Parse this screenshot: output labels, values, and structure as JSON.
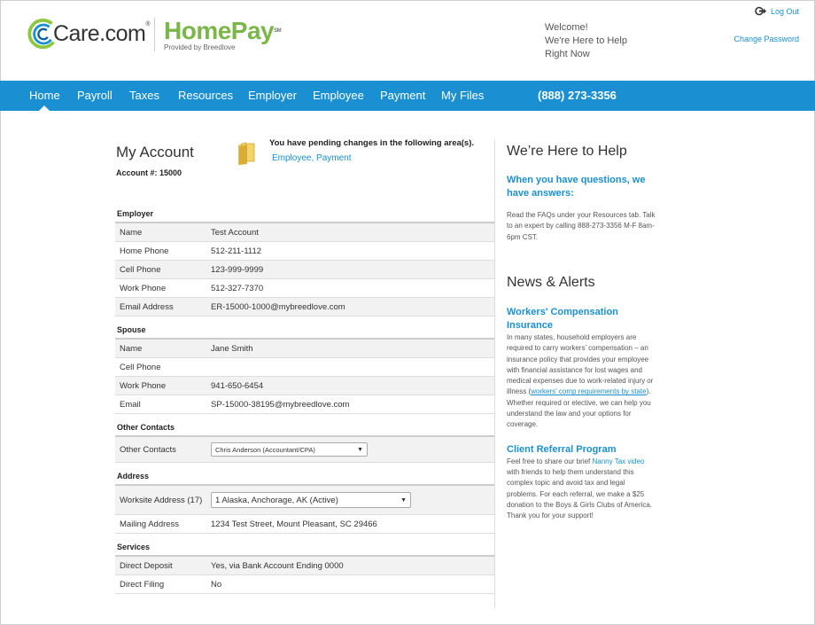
{
  "header": {
    "care_logo": "Care.com",
    "homepay_logo": "HomePay",
    "homepay_sub": "Provided by Breedlove",
    "welcome": [
      "Welcome!",
      "We're Here to Help",
      "Right Now"
    ],
    "logout": "Log Out",
    "change_password": "Change Password"
  },
  "nav": {
    "items": [
      "Home",
      "Payroll",
      "Taxes",
      "Resources",
      "Employer",
      "Employee",
      "Payment",
      "My Files"
    ],
    "phone": "(888) 273-3356",
    "active": "Home"
  },
  "account": {
    "title": "My Account",
    "number": "Account #: 15000",
    "pending_text": "You have pending changes in the following area(s).",
    "pending_links": "Employee, Payment"
  },
  "sections": {
    "employer": {
      "title": "Employer",
      "rows": [
        {
          "label": "Name",
          "value": "Test Account"
        },
        {
          "label": "Home Phone",
          "value": "512-211-1112"
        },
        {
          "label": "Cell Phone",
          "value": "123-999-9999"
        },
        {
          "label": "Work Phone",
          "value": "512-327-7370"
        },
        {
          "label": "Email Address",
          "value": "ER-15000-1000@mybreedlove.com"
        }
      ]
    },
    "spouse": {
      "title": "Spouse",
      "rows": [
        {
          "label": "Name",
          "value": "Jane Smith"
        },
        {
          "label": "Cell Phone",
          "value": ""
        },
        {
          "label": "Work Phone",
          "value": "941-650-6454"
        },
        {
          "label": "Email",
          "value": "SP-15000-38195@mybreedlove.com"
        }
      ]
    },
    "other": {
      "title": "Other Contacts",
      "label": "Other Contacts",
      "selected": "Chris Anderson (Accountant/CPA)"
    },
    "address": {
      "title": "Address",
      "worksite_label": "Worksite Address (17)",
      "worksite_selected": "1 Alaska, Anchorage, AK (Active)",
      "mailing_label": "Mailing Address",
      "mailing_value": "1234 Test Street, Mount Pleasant, SC 29466"
    },
    "services": {
      "title": "Services",
      "rows": [
        {
          "label": "Direct Deposit",
          "value": "Yes, via Bank Account Ending 0000"
        },
        {
          "label": "Direct Filing",
          "value": "No"
        }
      ]
    }
  },
  "help": {
    "title": "We’re Here to Help",
    "subtitle": "When you have questions, we have answers:",
    "text": "Read the FAQs under your Resources tab. Talk to an expert by calling 888-273-3356 M-F 8am-6pm CST."
  },
  "news": {
    "title": "News & Alerts",
    "items": [
      {
        "title": "Workers' Compensation Insurance",
        "text_before": "In many states, household employers are required to carry workers’ compensation – an insurance policy that provides your employee with financial assistance for lost wages and medical expenses due to work-related injury or illness (",
        "link": "workers' comp requirements by state",
        "text_after": ").  Whether required or elective, we can help you understand the law and your options for coverage."
      },
      {
        "title": "Client Referral Program",
        "text_before": "Feel free to share our brief ",
        "link": "Nanny Tax video",
        "text_after": " with friends to help them understand this complex topic and avoid tax and legal problems.  For each referral, we make a $25 donation to the Boys & Girls Clubs of America.  Thank you for your support!"
      }
    ]
  },
  "colors": {
    "nav_blue": "#1a8fd1",
    "homepay_green": "#7ab648",
    "link_blue": "#1a8fd1"
  }
}
